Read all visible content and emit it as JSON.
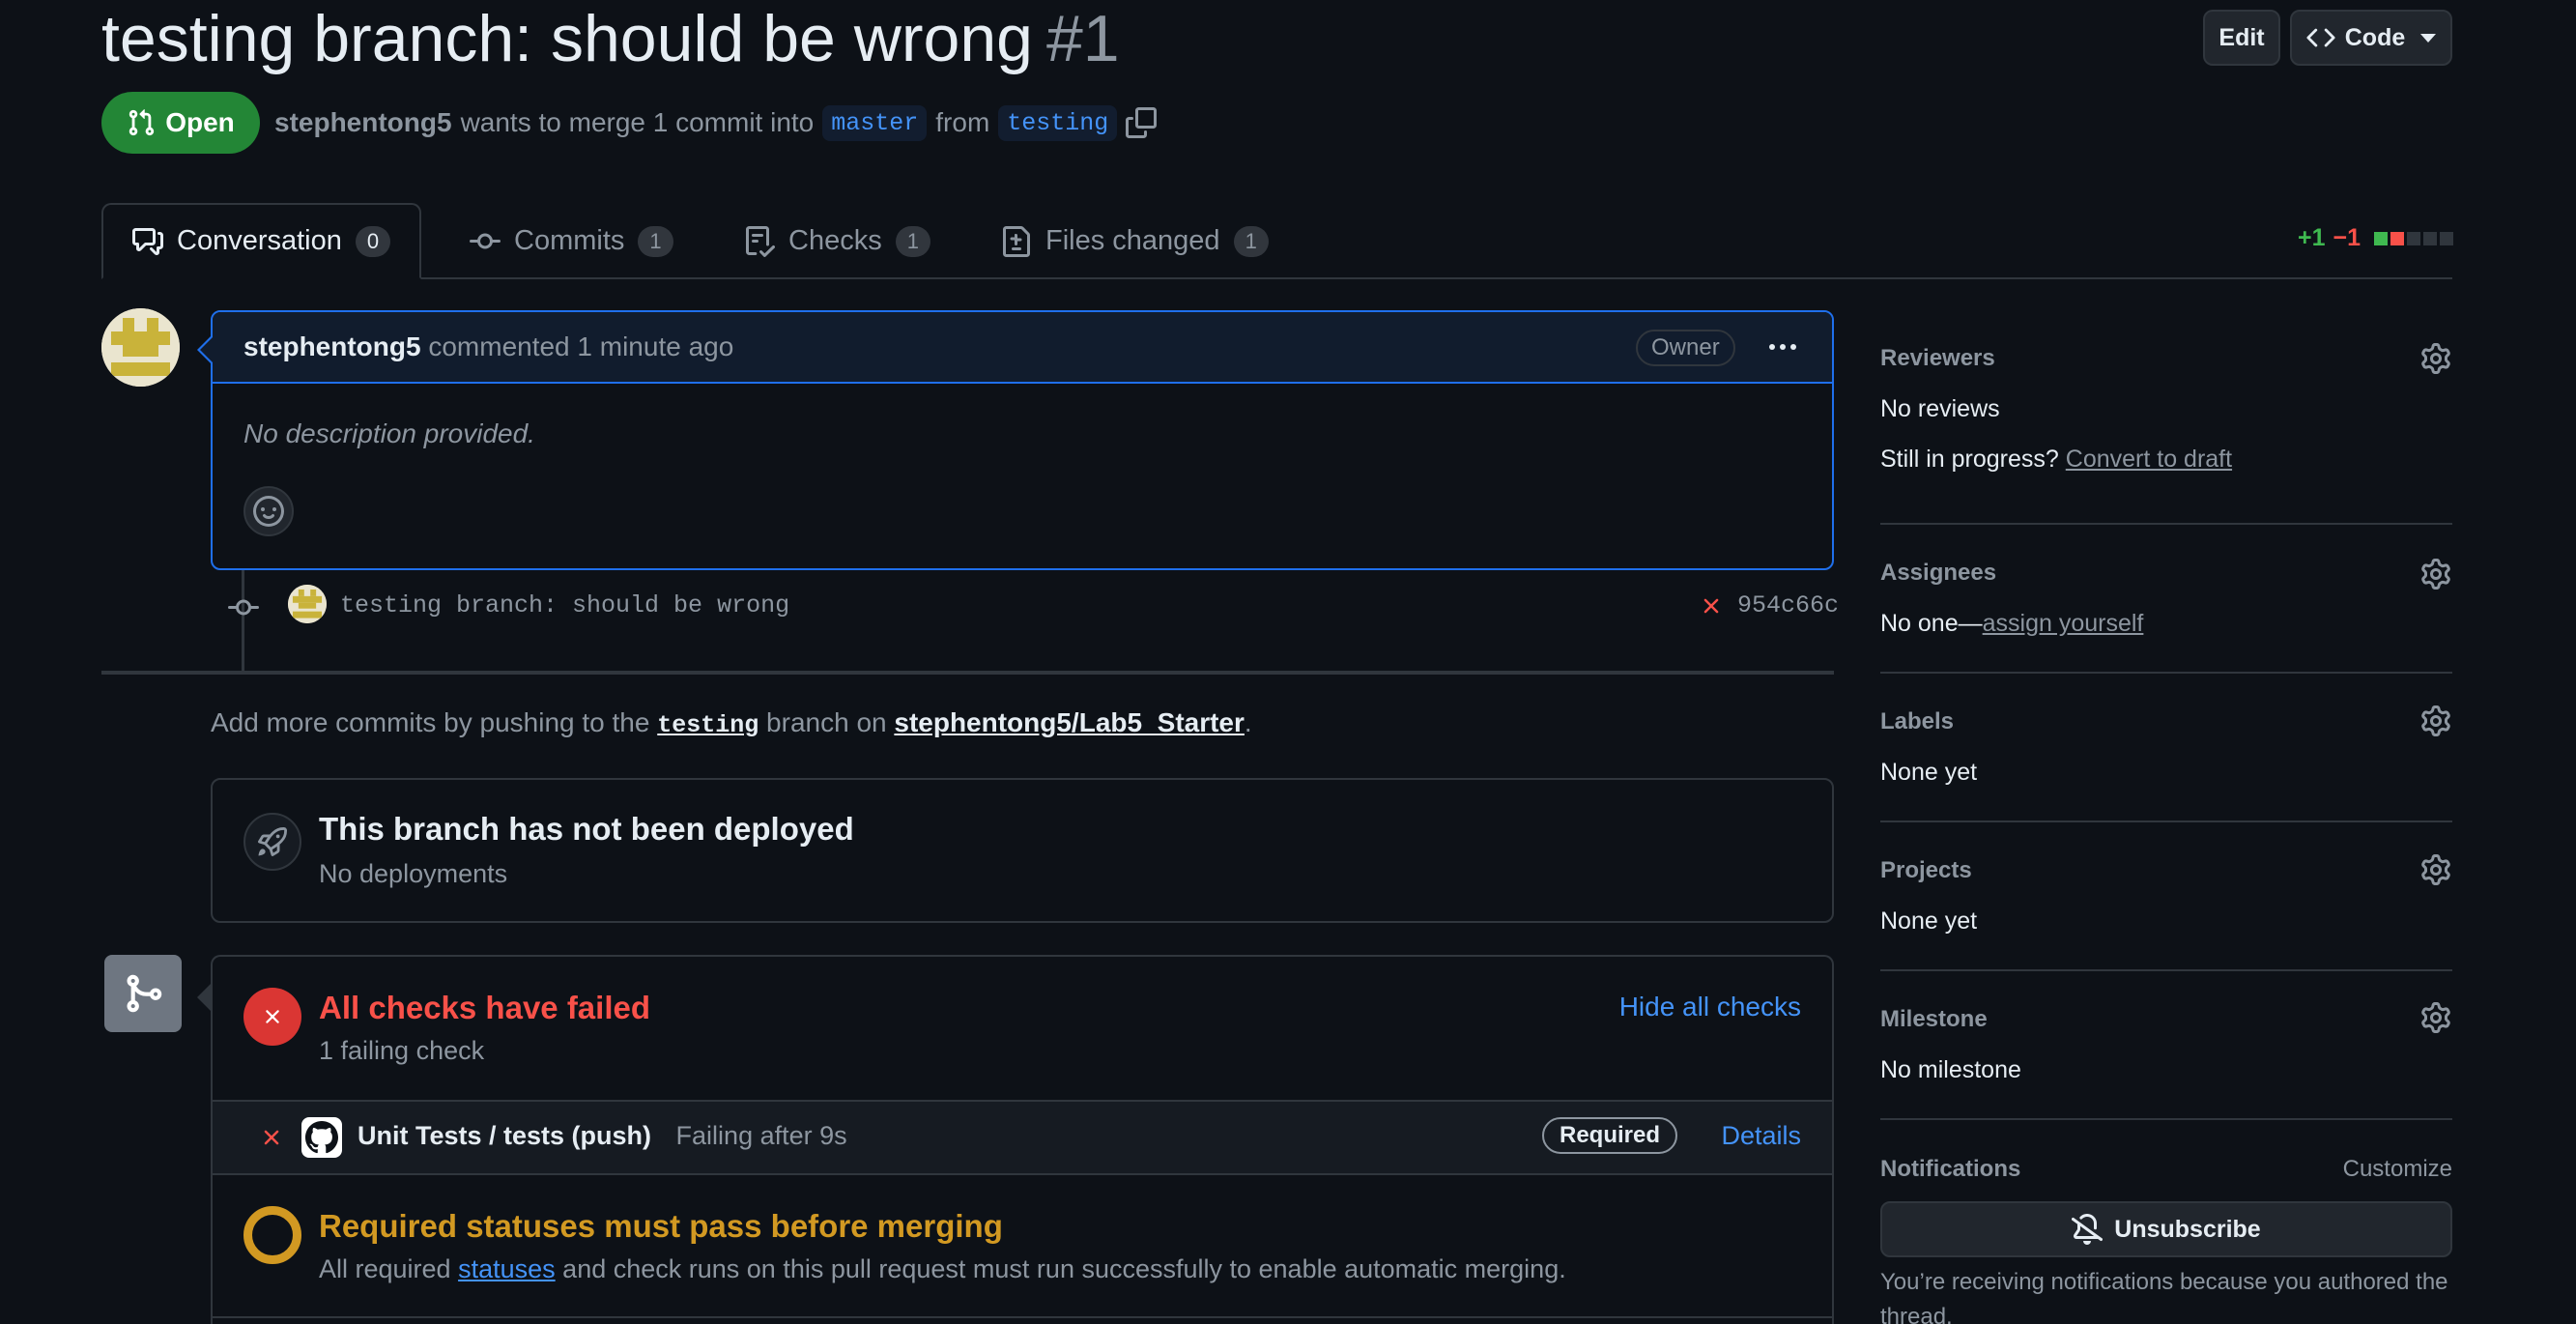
{
  "header": {
    "title": "testing branch: should be wrong",
    "number": "#1",
    "edit_label": "Edit",
    "code_label": "Code"
  },
  "state": {
    "label": "Open",
    "color": "#238636"
  },
  "meta": {
    "author": "stephentong5",
    "text_merge": "wants to merge 1 commit into",
    "base_branch": "master",
    "text_from": "from",
    "head_branch": "testing"
  },
  "tabs": [
    {
      "label": "Conversation",
      "count": "0",
      "icon": "comment-discussion-icon"
    },
    {
      "label": "Commits",
      "count": "1",
      "icon": "git-commit-icon"
    },
    {
      "label": "Checks",
      "count": "1",
      "icon": "checklist-icon"
    },
    {
      "label": "Files changed",
      "count": "1",
      "icon": "file-diff-icon"
    }
  ],
  "diffstat": {
    "additions": "+1",
    "deletions": "−1"
  },
  "comment": {
    "author": "stephentong5",
    "action": "commented 1 minute ago",
    "role": "Owner",
    "body": "No description provided."
  },
  "commit": {
    "message": "testing branch: should be wrong",
    "sha": "954c66c",
    "status": "failed"
  },
  "push_hint": {
    "prefix": "Add more commits by pushing to the",
    "branch": "testing",
    "middle": "branch on",
    "repo": "stephentong5/Lab5_Starter",
    "suffix": "."
  },
  "deploy": {
    "title": "This branch has not been deployed",
    "subtitle": "No deployments"
  },
  "checks": {
    "title": "All checks have failed",
    "subtitle": "1 failing check",
    "toggle_label": "Hide all checks",
    "items": [
      {
        "name": "Unit Tests / tests (push)",
        "status": "Failing after 9s",
        "badge": "Required",
        "link": "Details"
      }
    ]
  },
  "required": {
    "title": "Required statuses must pass before merging",
    "prefix": "All required",
    "link": "statuses",
    "suffix": "and check runs on this pull request must run successfully to enable automatic merging."
  },
  "sidebar": {
    "reviewers": {
      "heading": "Reviewers",
      "value": "No reviews",
      "draft_prefix": "Still in progress?",
      "draft_link": "Convert to draft"
    },
    "assignees": {
      "heading": "Assignees",
      "value": "No one—",
      "link": "assign yourself"
    },
    "labels": {
      "heading": "Labels",
      "value": "None yet"
    },
    "projects": {
      "heading": "Projects",
      "value": "None yet"
    },
    "milestone": {
      "heading": "Milestone",
      "value": "No milestone"
    },
    "notifications": {
      "heading": "Notifications",
      "customize": "Customize",
      "button": "Unsubscribe",
      "reason": "You’re receiving notifications because you authored the thread."
    }
  },
  "colors": {
    "background": "#0d1117",
    "accent": "#4493f8",
    "success": "#238636",
    "danger": "#da3633",
    "attention": "#d29922"
  }
}
